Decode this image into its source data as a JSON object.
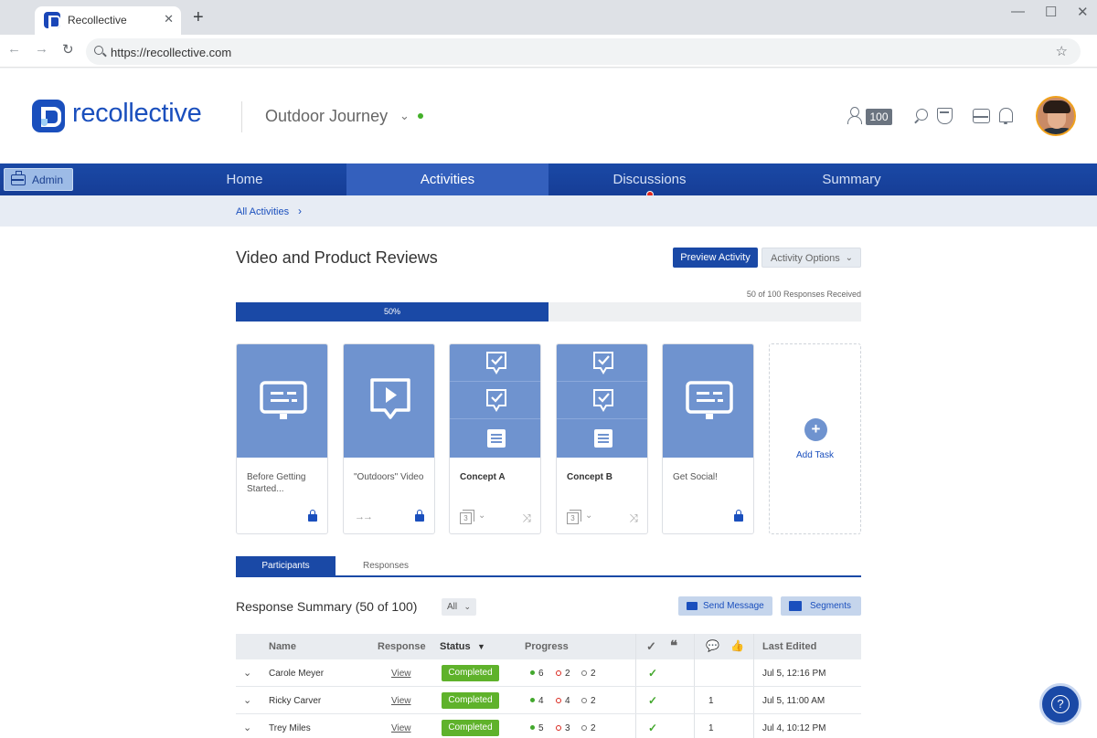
{
  "browser": {
    "tab_title": "Recollective",
    "url": "https://recollective.com"
  },
  "header": {
    "brand": "recollective",
    "project_name": "Outdoor Journey",
    "participant_count": "100"
  },
  "nav": {
    "admin_label": "Admin",
    "items": [
      "Home",
      "Activities",
      "Discussions",
      "Summary"
    ],
    "active": "Activities"
  },
  "breadcrumb": "All Activities",
  "activity": {
    "title": "Video and Product Reviews",
    "preview_label": "Preview Activity",
    "options_label": "Activity Options",
    "responses_received": "50 of 100 Responses Received",
    "progress_label": "50%",
    "progress_value": 0.5
  },
  "tasks": [
    {
      "label": "Before Getting Started...",
      "locked": true
    },
    {
      "label": "\"Outdoors\" Video",
      "locked": true
    },
    {
      "label": "Concept A",
      "stack_count": "3"
    },
    {
      "label": "Concept B",
      "stack_count": "3"
    },
    {
      "label": "Get Social!",
      "locked": true
    }
  ],
  "add_task_label": "Add Task",
  "tabs": [
    "Participants",
    "Responses"
  ],
  "summary": {
    "title": "Response Summary (50 of 100)",
    "filter": "All",
    "send_message_label": "Send Message",
    "segments_label": "Segments"
  },
  "table": {
    "headers": {
      "name": "Name",
      "response": "Response",
      "status": "Status",
      "progress": "Progress",
      "last_edited": "Last Edited"
    },
    "rows": [
      {
        "name": "Carole Meyer",
        "response": "View",
        "status": "Completed",
        "green": "6",
        "red": "2",
        "gray": "2",
        "check": "✓",
        "comments": "",
        "last_edited": "Jul 5, 12:16 PM"
      },
      {
        "name": "Ricky Carver",
        "response": "View",
        "status": "Completed",
        "green": "4",
        "red": "4",
        "gray": "2",
        "check": "✓",
        "comments": "1",
        "last_edited": "Jul 5, 11:00 AM"
      },
      {
        "name": "Trey Miles",
        "response": "View",
        "status": "Completed",
        "green": "5",
        "red": "3",
        "gray": "2",
        "check": "✓",
        "comments": "1",
        "last_edited": "Jul 4, 10:12 PM"
      }
    ]
  },
  "help_label": "?"
}
